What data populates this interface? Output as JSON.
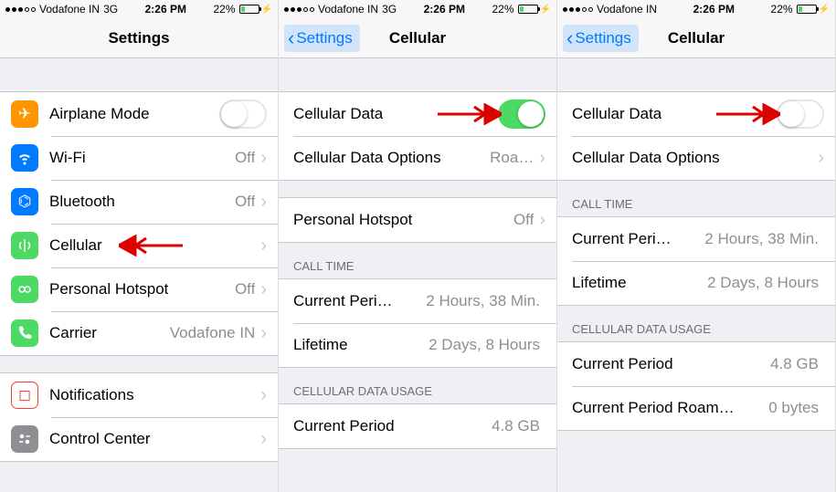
{
  "statusbar": {
    "carrier": "Vodafone IN",
    "network": "3G",
    "time": "2:26 PM",
    "battery_pct": "22%"
  },
  "pane1": {
    "title": "Settings",
    "rows": {
      "airplane": "Airplane Mode",
      "wifi": "Wi-Fi",
      "wifi_val": "Off",
      "bt": "Bluetooth",
      "bt_val": "Off",
      "cell": "Cellular",
      "hotspot": "Personal Hotspot",
      "hotspot_val": "Off",
      "carrier": "Carrier",
      "carrier_val": "Vodafone IN",
      "notif": "Notifications",
      "cc": "Control Center"
    }
  },
  "pane2": {
    "back": "Settings",
    "title": "Cellular",
    "cell_data": "Cellular Data",
    "cell_opts": "Cellular Data Options",
    "cell_opts_val": "Roa…",
    "hotspot": "Personal Hotspot",
    "hotspot_val": "Off",
    "hdr_calltime": "CALL TIME",
    "cur_period": "Current Peri…",
    "cur_period_val": "2 Hours, 38 Min.",
    "lifetime": "Lifetime",
    "lifetime_val": "2 Days, 8 Hours",
    "hdr_usage": "CELLULAR DATA USAGE",
    "usage_cur": "Current Period",
    "usage_cur_val": "4.8 GB"
  },
  "pane3": {
    "back": "Settings",
    "title": "Cellular",
    "cell_data": "Cellular Data",
    "cell_opts": "Cellular Data Options",
    "hdr_calltime": "CALL TIME",
    "cur_period": "Current Peri…",
    "cur_period_val": "2 Hours, 38 Min.",
    "lifetime": "Lifetime",
    "lifetime_val": "2 Days, 8 Hours",
    "hdr_usage": "CELLULAR DATA USAGE",
    "usage_cur": "Current Period",
    "usage_cur_val": "4.8 GB",
    "usage_roam": "Current Period Roam…",
    "usage_roam_val": "0 bytes"
  }
}
